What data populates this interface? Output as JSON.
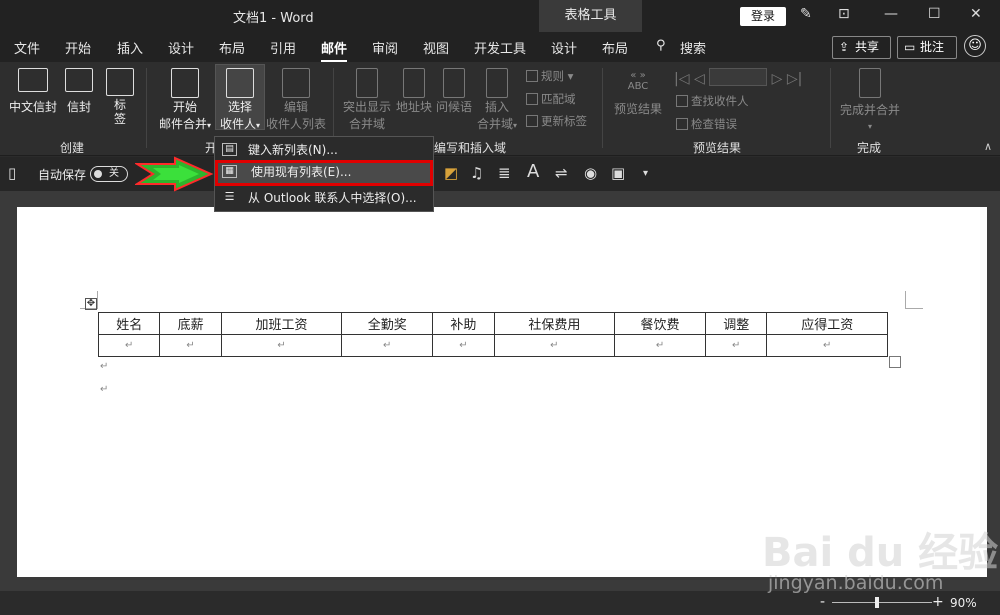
{
  "titlebar": {
    "doc_title": "文档1  -  Word",
    "context_tab": "表格工具",
    "login": "登录"
  },
  "menu": {
    "tabs": [
      "文件",
      "开始",
      "插入",
      "设计",
      "布局",
      "引用",
      "邮件",
      "审阅",
      "视图",
      "开发工具",
      "设计",
      "布局",
      "搜索"
    ],
    "active": "邮件",
    "share": "共享",
    "comments": "批注"
  },
  "ribbon": {
    "create": {
      "label": "创建",
      "buttons": [
        "中文信封",
        "信封",
        "标签"
      ]
    },
    "start_merge": {
      "label": "开",
      "start_btn": "开始",
      "start_btn2": "邮件合并",
      "select_btn": "选择",
      "select_btn2": "收件人",
      "edit_btn": "编辑",
      "edit_btn2": "收件人列表"
    },
    "write_insert": {
      "label": "编写和插入域",
      "highlight": "突出显示",
      "highlight2": "合并域",
      "address": "地址块",
      "greeting": "问候语",
      "insert": "插入",
      "insert2": "合并域",
      "rules": "规则",
      "match": "匹配域",
      "update": "更新标签"
    },
    "preview": {
      "label": "预览结果",
      "preview_btn": "预览结果",
      "abc": "ABC",
      "find": "查找收件人",
      "check": "检查错误"
    },
    "finish": {
      "label": "完成",
      "btn": "完成并合并"
    }
  },
  "qat": {
    "autosave": "自动保存",
    "toggle": "关"
  },
  "dropdown": {
    "items": [
      "键入新列表(N)...",
      "使用现有列表(E)...",
      "从 Outlook 联系人中选择(O)..."
    ]
  },
  "document": {
    "table_headers": [
      "姓名",
      "底薪",
      "加班工资",
      "全勤奖",
      "补助",
      "社保费用",
      "餐饮费",
      "调整",
      "应得工资"
    ]
  },
  "status": {
    "zoom": "90%"
  },
  "watermark": {
    "brand": "Bai du 经验",
    "url": "jingyan.baidu.com"
  }
}
